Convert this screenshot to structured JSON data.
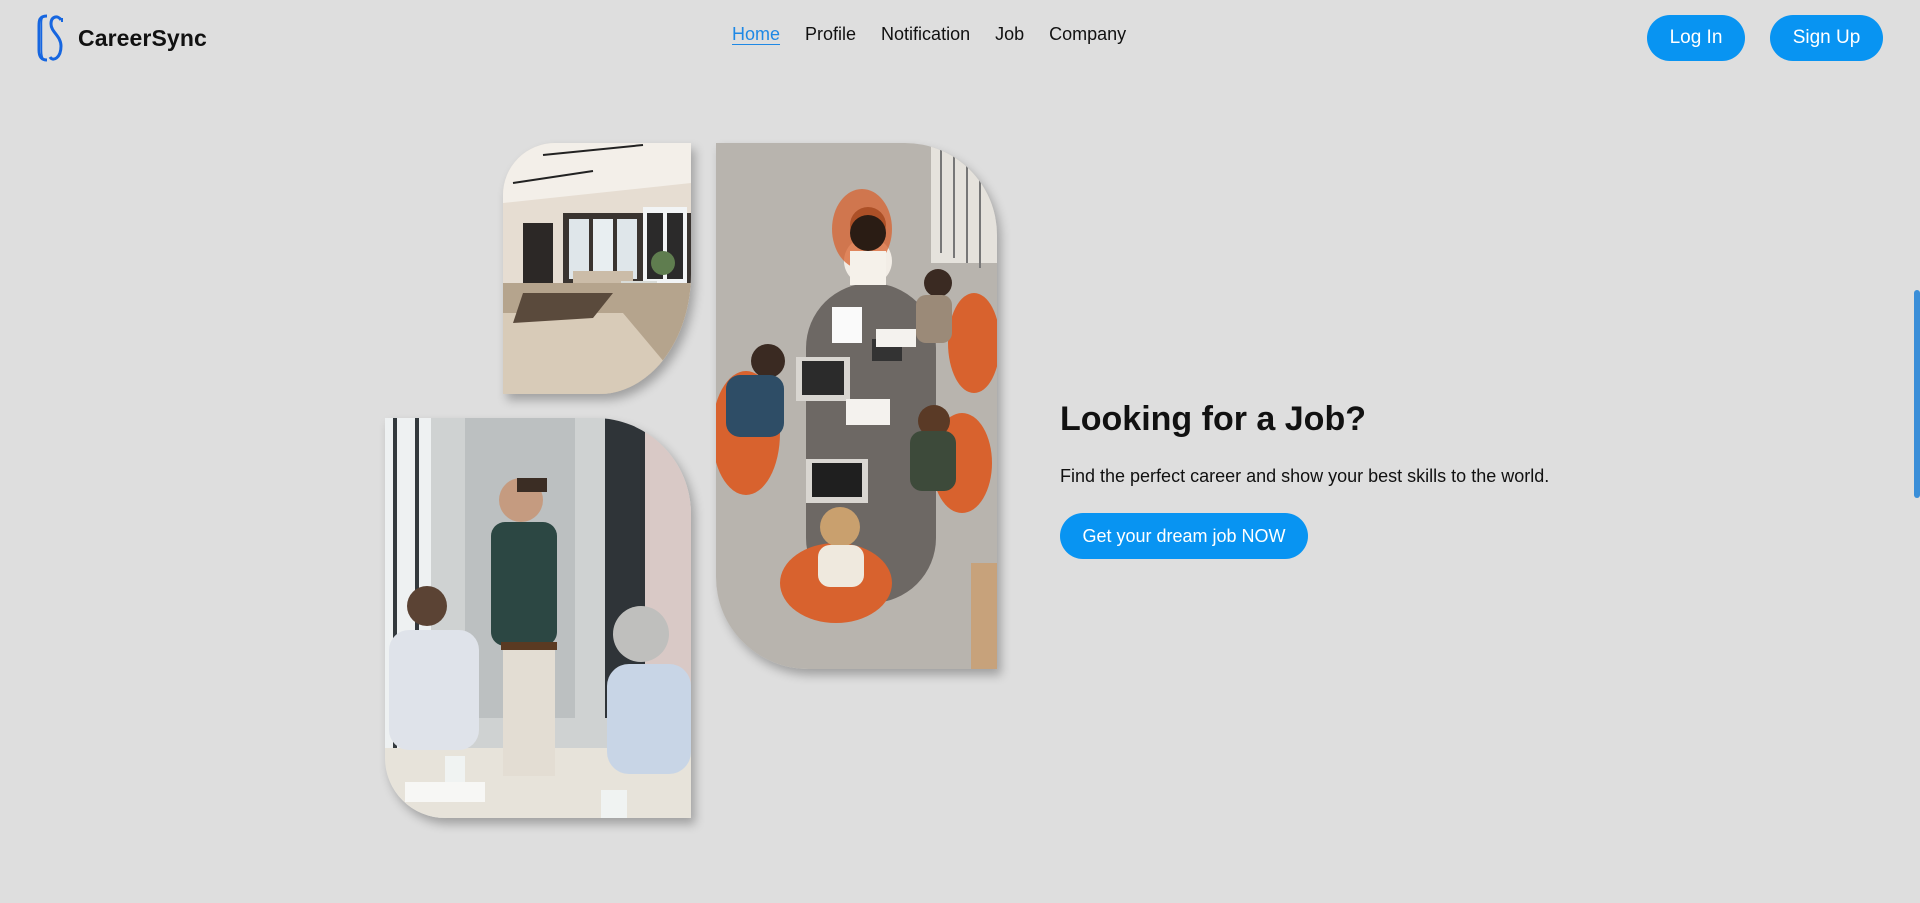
{
  "brand": {
    "name": "CareerSync",
    "logo_icon": "cs-monogram-icon",
    "logo_color": "#1666e0"
  },
  "nav": {
    "items": [
      {
        "label": "Home",
        "active": true
      },
      {
        "label": "Profile",
        "active": false
      },
      {
        "label": "Notification",
        "active": false
      },
      {
        "label": "Job",
        "active": false
      },
      {
        "label": "Company",
        "active": false
      }
    ],
    "active_color": "#1e88e5"
  },
  "auth": {
    "login_label": "Log In",
    "signup_label": "Sign Up"
  },
  "hero": {
    "title": "Looking for a Job?",
    "subtitle": "Find the perfect career and show your best skills to the world.",
    "cta_label": "Get your dream job NOW",
    "images": [
      {
        "name": "office-interior-photo"
      },
      {
        "name": "team-meeting-overhead-photo"
      },
      {
        "name": "business-discussion-photo"
      }
    ]
  },
  "theme": {
    "accent": "#0894f2",
    "background": "#dedede"
  }
}
